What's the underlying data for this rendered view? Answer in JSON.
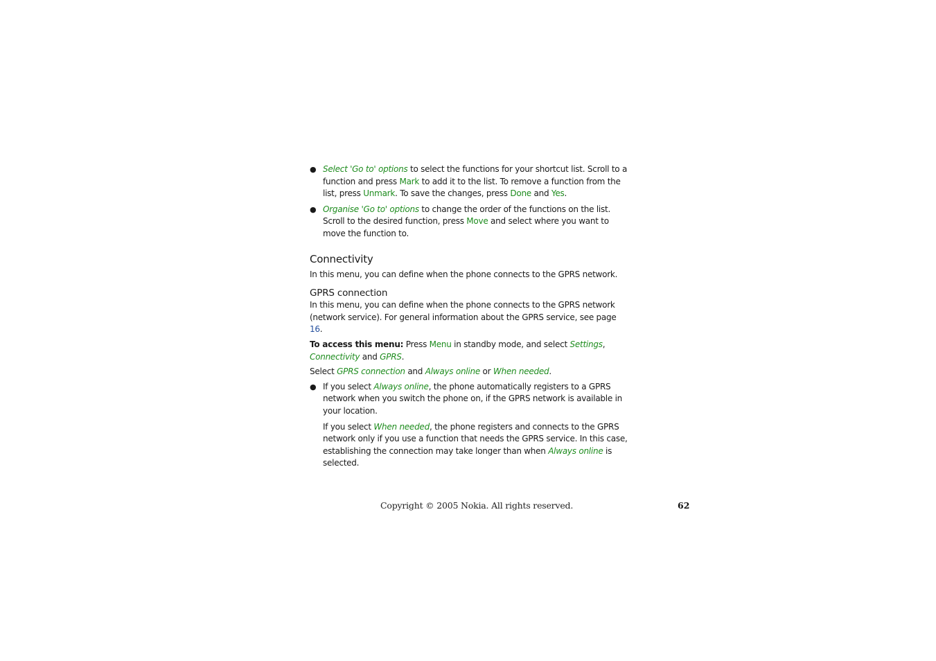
{
  "bullets_top": [
    {
      "parts": [
        {
          "t": "Select 'Go to' options",
          "s": "gi"
        },
        {
          "t": " to select the functions for your shortcut list. Scroll to a function and press ",
          "s": ""
        },
        {
          "t": "Mark",
          "s": "g"
        },
        {
          "t": " to add it to the list. To remove a function from the list, press ",
          "s": ""
        },
        {
          "t": "Unmark",
          "s": "g"
        },
        {
          "t": ". To save the changes, press ",
          "s": ""
        },
        {
          "t": "Done",
          "s": "g"
        },
        {
          "t": " and ",
          "s": ""
        },
        {
          "t": "Yes",
          "s": "g"
        },
        {
          "t": ".",
          "s": ""
        }
      ]
    },
    {
      "parts": [
        {
          "t": "Organise 'Go to' options",
          "s": "gi"
        },
        {
          "t": " to change the order of the functions on the list. Scroll to the desired function, press ",
          "s": ""
        },
        {
          "t": "Move",
          "s": "g"
        },
        {
          "t": " and select where you want to move the function to.",
          "s": ""
        }
      ]
    }
  ],
  "connectivity": {
    "title": "Connectivity",
    "intro": "In this menu, you can define when the phone connects to the GPRS network."
  },
  "gprs": {
    "title": "GPRS connection",
    "intro_text": "In this menu, you can define when the phone connects to the GPRS network (network service). For general information about the GPRS service, see page ",
    "page_link": "16",
    "intro_end": ".",
    "access": {
      "label": "To access this menu:",
      "parts": [
        {
          "t": " Press ",
          "s": ""
        },
        {
          "t": "Menu",
          "s": "g"
        },
        {
          "t": " in standby mode, and select ",
          "s": ""
        },
        {
          "t": "Settings",
          "s": "gi"
        },
        {
          "t": ", ",
          "s": ""
        },
        {
          "t": "Connectivity",
          "s": "gi"
        },
        {
          "t": " and ",
          "s": ""
        },
        {
          "t": "GPRS",
          "s": "gi"
        },
        {
          "t": ".",
          "s": ""
        }
      ]
    },
    "select_line": [
      {
        "t": "Select ",
        "s": ""
      },
      {
        "t": "GPRS connection",
        "s": "gi"
      },
      {
        "t": " and ",
        "s": ""
      },
      {
        "t": "Always online",
        "s": "gi"
      },
      {
        "t": " or ",
        "s": ""
      },
      {
        "t": "When needed",
        "s": "gi"
      },
      {
        "t": ".",
        "s": ""
      }
    ],
    "bullet_always": [
      {
        "t": "If you select ",
        "s": ""
      },
      {
        "t": "Always online",
        "s": "gi"
      },
      {
        "t": ", the phone automatically registers to a GPRS network when you switch the phone on, if the GPRS network is available in your location.",
        "s": ""
      }
    ],
    "para_when": [
      {
        "t": "If you select ",
        "s": ""
      },
      {
        "t": "When needed",
        "s": "gi"
      },
      {
        "t": ", the phone registers and connects to the GPRS network only if you use a function that needs the GPRS service. In this case, establishing the connection may take longer than when ",
        "s": ""
      },
      {
        "t": "Always online",
        "s": "gi"
      },
      {
        "t": " is selected.",
        "s": ""
      }
    ]
  },
  "footer": {
    "copyright": "Copyright © 2005 Nokia. All rights reserved.",
    "page_number": "62"
  },
  "colors": {
    "highlight_green": "#1e8c1e",
    "link_blue": "#244f9e",
    "text": "#1a1a1a"
  }
}
